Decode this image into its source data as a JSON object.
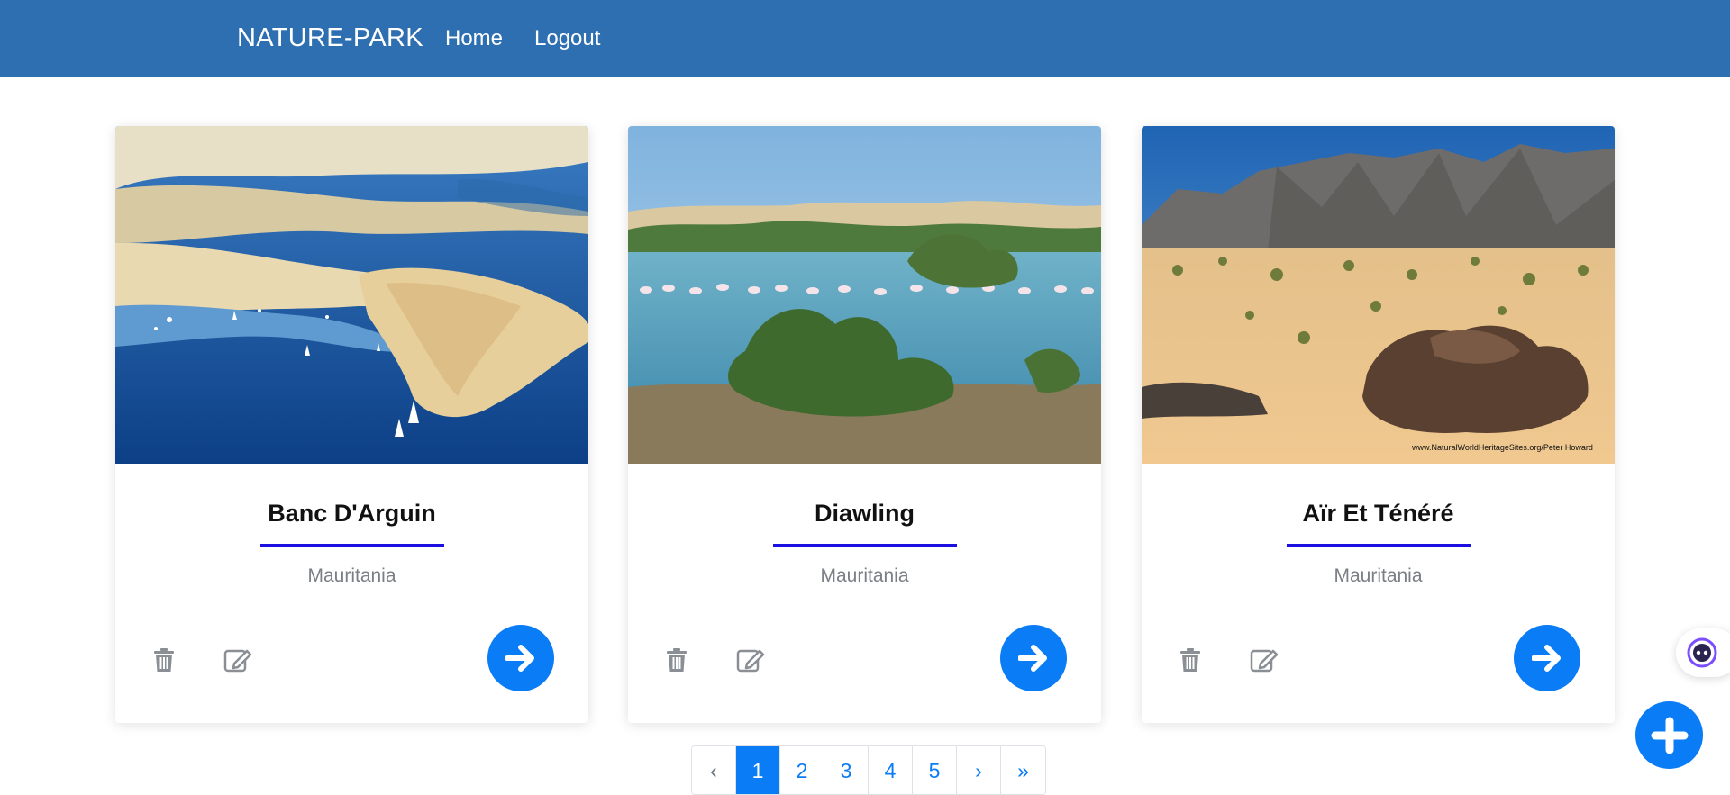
{
  "navbar": {
    "brand": "NATURE-PARK",
    "links": [
      {
        "label": "Home"
      },
      {
        "label": "Logout"
      }
    ],
    "background": "#2e6fb2"
  },
  "cards": [
    {
      "title": "Banc D'Arguin",
      "country": "Mauritania",
      "image": "coastal-sandbank-aerial"
    },
    {
      "title": "Diawling",
      "country": "Mauritania",
      "image": "lake-with-flamingos"
    },
    {
      "title": "Aïr Et Ténéré",
      "country": "Mauritania",
      "image": "desert-mountains-rocks",
      "image_credit": "www.NaturalWorldHeritageSites.org/Peter Howard"
    }
  ],
  "card_actions": {
    "delete_icon": "trash-icon",
    "edit_icon": "edit-icon",
    "open_icon": "arrow-right-icon"
  },
  "pagination": {
    "prev": "‹",
    "pages": [
      "1",
      "2",
      "3",
      "4",
      "5"
    ],
    "current": "1",
    "next": "›",
    "last": "»"
  },
  "fab": {
    "icon": "plus-icon"
  },
  "assistant": {
    "icon": "assistant-bot-icon"
  },
  "colors": {
    "accent": "#0a7cf5",
    "title_underline": "#1c10e0",
    "muted_text": "#7a7f86"
  }
}
